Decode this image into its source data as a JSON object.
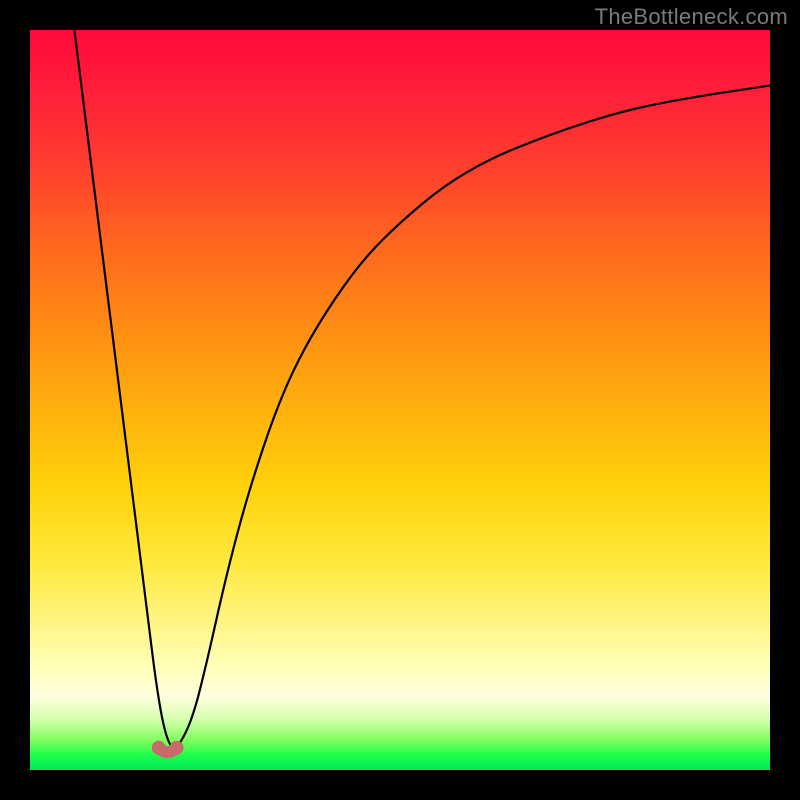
{
  "watermark": "TheBottleneck.com",
  "chart_data": {
    "type": "line",
    "title": "",
    "xlabel": "",
    "ylabel": "",
    "xlim": [
      0,
      100
    ],
    "ylim": [
      0,
      100
    ],
    "grid": false,
    "series": [
      {
        "name": "bottleneck-curve",
        "x": [
          6,
          8,
          10,
          12,
          14,
          16,
          17,
          18,
          19,
          20,
          22,
          24,
          26,
          28,
          30,
          33,
          36,
          40,
          45,
          50,
          56,
          62,
          68,
          75,
          82,
          90,
          100
        ],
        "values": [
          100,
          84,
          68,
          52,
          36,
          20,
          12,
          6,
          3,
          3,
          7,
          15,
          24,
          32,
          39,
          48,
          55,
          62,
          69,
          74,
          79,
          82.5,
          85,
          87.5,
          89.5,
          91,
          92.5
        ]
      }
    ],
    "markers": [
      {
        "name": "valley-left-dot",
        "x": 17.4,
        "y": 3.0
      },
      {
        "name": "valley-right-dot",
        "x": 19.8,
        "y": 3.0
      }
    ],
    "colors": {
      "curve": "#000000",
      "marker": "#c96a6a",
      "gradient_top": "#ff0a3a",
      "gradient_mid": "#ffd20a",
      "gradient_bottom": "#00e85a"
    }
  }
}
